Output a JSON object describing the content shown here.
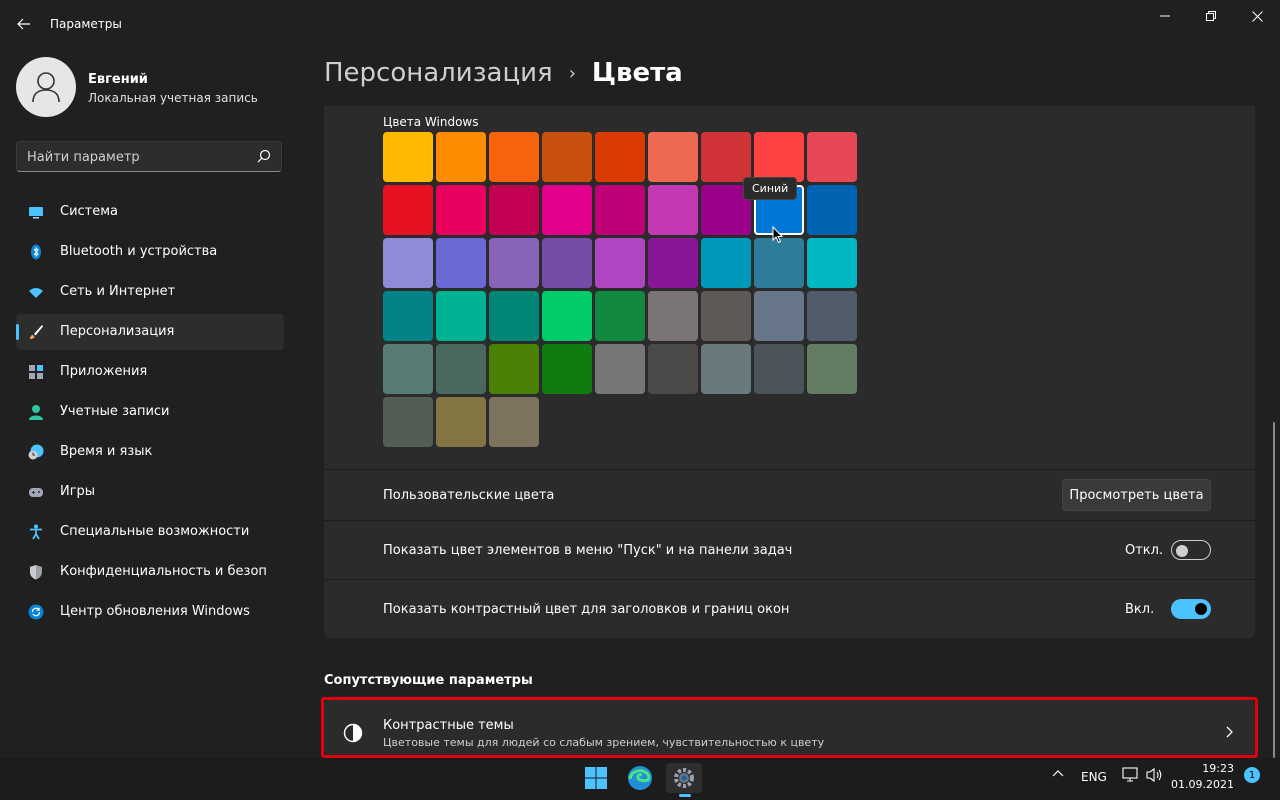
{
  "window": {
    "title": "Параметры",
    "back_icon": "back-arrow-icon",
    "controls": [
      "minimize-icon",
      "maximize-icon",
      "close-icon"
    ]
  },
  "profile": {
    "name": "Евгений",
    "account_type": "Локальная учетная запись"
  },
  "search": {
    "placeholder": "Найти параметр",
    "value": ""
  },
  "sidebar": {
    "items": [
      {
        "label": "Система",
        "icon": "system-icon"
      },
      {
        "label": "Bluetooth и устройства",
        "icon": "bluetooth-icon"
      },
      {
        "label": "Сеть и Интернет",
        "icon": "wifi-icon"
      },
      {
        "label": "Персонализация",
        "icon": "brush-icon",
        "active": true
      },
      {
        "label": "Приложения",
        "icon": "apps-icon"
      },
      {
        "label": "Учетные записи",
        "icon": "person-icon"
      },
      {
        "label": "Время и язык",
        "icon": "clock-globe-icon"
      },
      {
        "label": "Игры",
        "icon": "gamepad-icon"
      },
      {
        "label": "Специальные возможности",
        "icon": "accessibility-icon"
      },
      {
        "label": "Конфиденциальность и безопас",
        "icon": "shield-icon"
      },
      {
        "label": "Центр обновления Windows",
        "icon": "update-icon"
      }
    ]
  },
  "header": {
    "parent": "Персонализация",
    "separator": "›",
    "current": "Цвета"
  },
  "windows_colors": {
    "heading": "Цвета Windows",
    "selected_index": 16,
    "tooltip": "Синий",
    "swatches": [
      "#FFB900",
      "#FF8C00",
      "#F7630C",
      "#CA5010",
      "#DA3B01",
      "#EF6950",
      "#D13438",
      "#FF4343",
      "#E74856",
      "#E81123",
      "#EA005E",
      "#C30052",
      "#E3008C",
      "#BF0077",
      "#C239B3",
      "#9A0089",
      "#0078D7",
      "#0063B1",
      "#8E8CD8",
      "#6B69D6",
      "#8764B8",
      "#744DA9",
      "#B146C2",
      "#881798",
      "#0099BC",
      "#2D7D9A",
      "#00B7C3",
      "#038387",
      "#00B294",
      "#018574",
      "#00CC6A",
      "#10893E",
      "#7A7574",
      "#5D5A58",
      "#68768A",
      "#515C6B",
      "#567C73",
      "#486860",
      "#498205",
      "#107C10",
      "#767676",
      "#4C4A48",
      "#69797E",
      "#4A5459",
      "#647C64",
      "#525E54",
      "#847545",
      "#7E735F"
    ]
  },
  "custom_colors": {
    "label": "Пользовательские цвета",
    "button": "Просмотреть цвета"
  },
  "accent_start_taskbar": {
    "label": "Показать цвет элементов в меню \"Пуск\" и на панели задач",
    "state_text": "Откл.",
    "on": false
  },
  "accent_title_bars": {
    "label": "Показать контрастный цвет для заголовков и границ окон",
    "state_text": "Вкл.",
    "on": true
  },
  "related": {
    "heading": "Сопутствующие параметры",
    "contrast_themes": {
      "title": "Контрастные темы",
      "description": "Цветовые темы для людей со слабым зрением, чувствительностью к цвету",
      "icon": "contrast-icon"
    }
  },
  "taskbar": {
    "icons": [
      "windows-start-icon",
      "edge-browser-icon",
      "settings-gear-icon"
    ],
    "language": "ENG",
    "time": "19:23",
    "date": "01.09.2021",
    "notification_count": "1"
  },
  "colors": {
    "accent": "#4cc2ff",
    "highlight": "#e0000e",
    "background": "#202020",
    "card": "#2b2b2b"
  }
}
